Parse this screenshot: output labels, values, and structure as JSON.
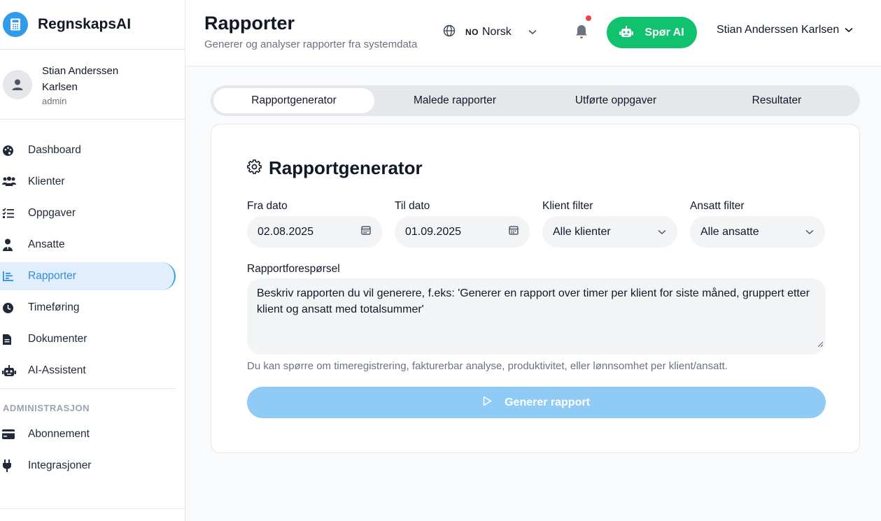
{
  "app": {
    "name": "RegnskapsAI",
    "brand_color": "#2f9bea"
  },
  "profile": {
    "name": "Stian Anderssen Karlsen",
    "role": "admin"
  },
  "sidebar": {
    "items": [
      {
        "label": "Dashboard",
        "icon": "palette-icon"
      },
      {
        "label": "Klienter",
        "icon": "people-icon"
      },
      {
        "label": "Oppgaver",
        "icon": "checklist-icon"
      },
      {
        "label": "Ansatte",
        "icon": "employee-icon"
      },
      {
        "label": "Rapporter",
        "icon": "chart-icon",
        "active": true
      },
      {
        "label": "Timeføring",
        "icon": "clock-icon"
      },
      {
        "label": "Dokumenter",
        "icon": "document-icon"
      },
      {
        "label": "AI-Assistent",
        "icon": "robot-icon"
      }
    ],
    "admin_section": "ADMINISTRASJON",
    "admin_items": [
      {
        "label": "Abonnement",
        "icon": "credit-card-icon"
      },
      {
        "label": "Integrasjoner",
        "icon": "plug-icon"
      }
    ]
  },
  "header": {
    "title": "Rapporter",
    "subtitle": "Generer og analyser rapporter fra systemdata",
    "language_code": "NO",
    "language_name": "Norsk",
    "ask_ai_label": "Spør AI",
    "user_name": "Stian Anderssen Karlsen",
    "accent_green": "#10c26e"
  },
  "tabs": [
    "Rapportgenerator",
    "Malede rapporter",
    "Utførte oppgaver",
    "Resultater"
  ],
  "active_tab": "Rapportgenerator",
  "generator": {
    "title": "Rapportgenerator",
    "from_label": "Fra dato",
    "from_value": "02.08.2025",
    "to_label": "Til dato",
    "to_value": "01.09.2025",
    "client_filter_label": "Klient filter",
    "client_filter_value": "Alle klienter",
    "employee_filter_label": "Ansatt filter",
    "employee_filter_value": "Alle ansatte",
    "request_label": "Rapportforespørsel",
    "request_placeholder": "Beskriv rapporten du vil generere, f.eks: 'Generer en rapport over timer per klient for siste måned, gruppert etter klient og ansatt med totalsummer'",
    "hint": "Du kan spørre om timeregistrering, fakturerbar analyse, produktivitet, eller lønnsomhet per klient/ansatt.",
    "generate_label": "Generer rapport"
  }
}
